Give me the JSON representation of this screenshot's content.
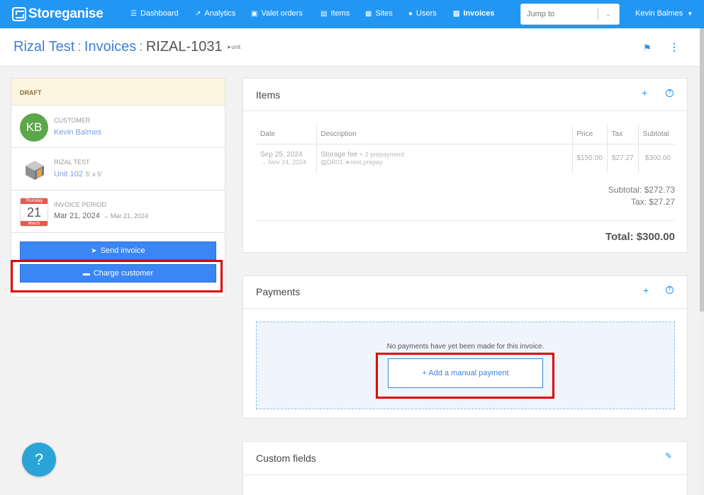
{
  "app": {
    "brand": "Storeganise",
    "accent": "#2196f3"
  },
  "nav": {
    "items": [
      {
        "label": "Dashboard",
        "icon": "sitemap-icon"
      },
      {
        "label": "Analytics",
        "icon": "chart-line-icon"
      },
      {
        "label": "Valet orders",
        "icon": "truck-icon"
      },
      {
        "label": "Items",
        "icon": "archive-icon"
      },
      {
        "label": "Sites",
        "icon": "building-icon"
      },
      {
        "label": "Users",
        "icon": "user-icon"
      },
      {
        "label": "Invoices",
        "icon": "invoice-icon"
      }
    ],
    "active": "Invoices",
    "jump_placeholder": "Jump to",
    "user_name": "Kevin Balmes"
  },
  "header": {
    "crumb_1": "Rizal Test",
    "crumb_2": "Invoices",
    "crumb_3": "RIZAL-1031",
    "tag": "unit"
  },
  "left": {
    "status": "DRAFT",
    "customer_label": "CUSTOMER",
    "customer_initials": "KB",
    "customer_name": "Kevin Balmes",
    "site_label": "RIZAL TEST",
    "unit_name": "Unit 102",
    "unit_size": "5' x 5'",
    "period_label": "INVOICE PERIOD",
    "cal_weekday": "Thursday",
    "cal_day": "21",
    "cal_month": "March",
    "period_start": "Mar 21, 2024",
    "period_end": "Mar 21, 2024",
    "send_label": "Send invoice",
    "charge_label": "Charge customer"
  },
  "items_card": {
    "title": "Items",
    "columns": [
      "Date",
      "Description",
      "Price",
      "Tax",
      "Subtotal"
    ],
    "row": {
      "date": "Sep 25, 2024",
      "date_end": "Nov 24, 2024",
      "desc": "Storage fee",
      "desc_qty": "× 2 prepayment",
      "unit_code": "DR01",
      "tags": "rent,prepay",
      "price": "$150.00",
      "tax": "$27.27",
      "subtotal": "$300.00"
    },
    "subtotal_line": "Subtotal: $272.73",
    "tax_line": "Tax: $27.27",
    "total_line": "Total: $300.00"
  },
  "payments_card": {
    "title": "Payments",
    "empty_msg": "No payments have yet been made for this invoice.",
    "add_label": "+ Add a manual payment"
  },
  "custom_card": {
    "title": "Custom fields"
  },
  "help_label": "?"
}
